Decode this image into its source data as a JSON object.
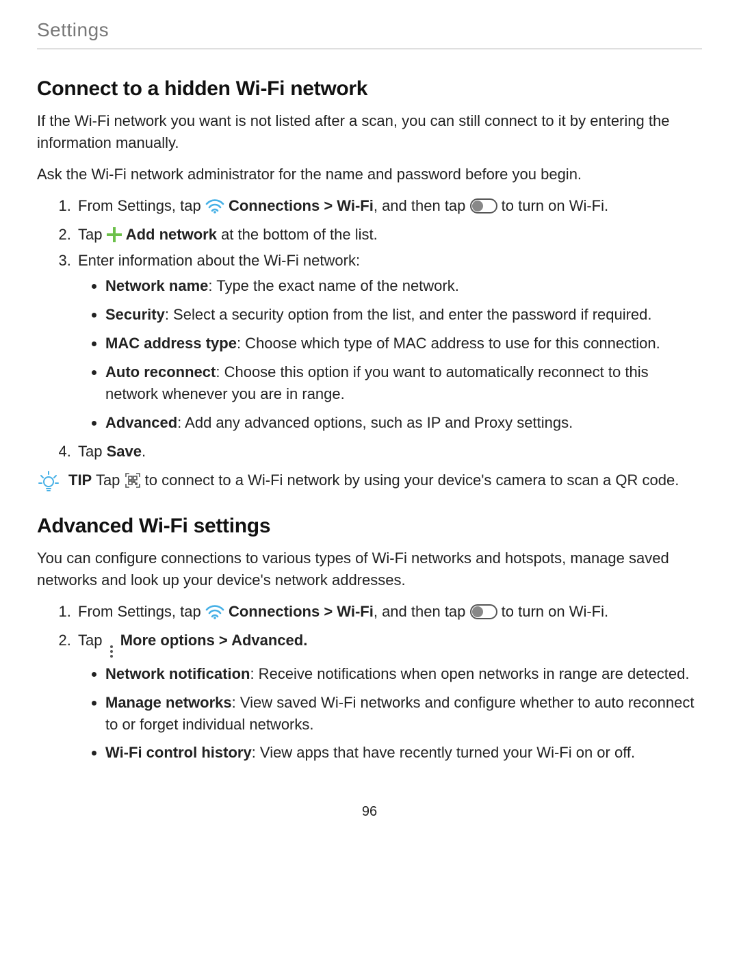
{
  "header": {
    "title": "Settings"
  },
  "section1": {
    "heading": "Connect to a hidden Wi-Fi network",
    "intro1": "If the Wi-Fi network you want is not listed after a scan, you can still connect to it by entering the information manually.",
    "intro2": "Ask the Wi-Fi network administrator for the name and password before you begin.",
    "step1_a": "From Settings, tap ",
    "step1_b": "Connections > Wi-Fi",
    "step1_c": ", and then tap ",
    "step1_d": " to turn on Wi-Fi.",
    "step2_a": "Tap ",
    "step2_b": "Add network",
    "step2_c": " at the bottom of the list.",
    "step3": "Enter information about the Wi-Fi network:",
    "bullets": [
      {
        "label": "Network name",
        "text": ": Type the exact name of the network."
      },
      {
        "label": "Security",
        "text": ": Select a security option from the list, and enter the password if required."
      },
      {
        "label": "MAC address type",
        "text": ": Choose which type of MAC address to use for this connection."
      },
      {
        "label": "Auto reconnect",
        "text": ": Choose this option if you want to automatically reconnect to this network whenever you are in range."
      },
      {
        "label": "Advanced",
        "text": ": Add any advanced options, such as IP and Proxy settings."
      }
    ],
    "step4_a": "Tap ",
    "step4_b": "Save",
    "step4_c": ".",
    "tip_label": "TIP",
    "tip_a": "  Tap ",
    "tip_b": " to connect to a Wi-Fi network by using your device's camera to scan a QR code."
  },
  "section2": {
    "heading": "Advanced Wi-Fi settings",
    "intro": "You can configure connections to various types of Wi-Fi networks and hotspots, manage saved networks and look up your device's network addresses.",
    "step1_a": "From Settings, tap ",
    "step1_b": "Connections > Wi-Fi",
    "step1_c": ", and then tap ",
    "step1_d": " to turn on Wi-Fi.",
    "step2_a": "Tap ",
    "step2_b": "More options > Advanced.",
    "bullets": [
      {
        "label": "Network notification",
        "text": ": Receive notifications when open networks in range are detected."
      },
      {
        "label": "Manage networks",
        "text": ": View saved Wi-Fi networks and configure whether to auto reconnect to or forget individual networks."
      },
      {
        "label": "Wi-Fi control history",
        "text": ": View apps that have recently turned your Wi-Fi on or off."
      }
    ]
  },
  "page_number": "96"
}
